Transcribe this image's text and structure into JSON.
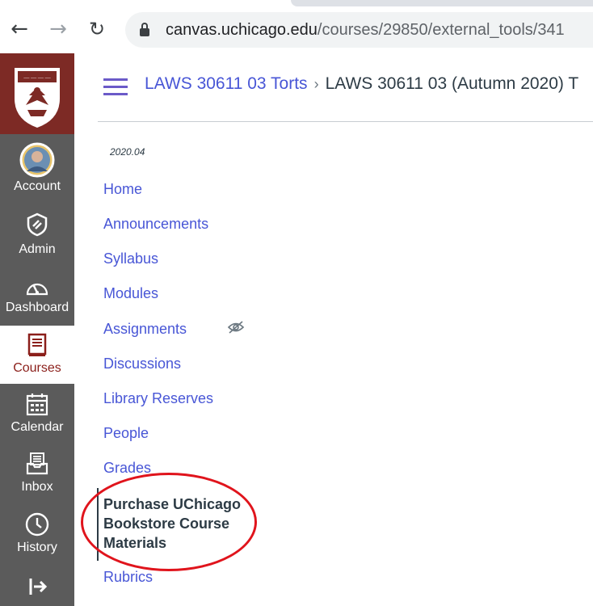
{
  "browser": {
    "back_icon": "arrow-left-icon",
    "forward_icon": "arrow-right-icon",
    "reload_icon": "reload-icon",
    "url_host": "canvas.uchicago.edu",
    "url_path": "/courses/29850/external_tools/341"
  },
  "global_nav": {
    "items": [
      {
        "label": "Account",
        "icon": "user-avatar"
      },
      {
        "label": "Admin",
        "icon": "shield-icon"
      },
      {
        "label": "Dashboard",
        "icon": "speedometer-icon"
      },
      {
        "label": "Courses",
        "icon": "book-icon",
        "active": true
      },
      {
        "label": "Calendar",
        "icon": "calendar-icon"
      },
      {
        "label": "Inbox",
        "icon": "inbox-icon"
      },
      {
        "label": "History",
        "icon": "clock-icon"
      }
    ],
    "colors": {
      "nav_bg": "#5b5b5b",
      "logo_bg": "#7d2a25",
      "active_text": "#8b1f1a"
    }
  },
  "header": {
    "course_link": "LAWS 30611 03 Torts",
    "separator": "›",
    "current": "LAWS 30611 03 (Autumn 2020) T"
  },
  "course_nav": {
    "term": "2020.04",
    "items": [
      "Home",
      "Announcements",
      "Syllabus",
      "Modules",
      "Assignments",
      "Discussions",
      "Library Reserves",
      "People",
      "Grades"
    ],
    "active_item": "Purchase UChicago Bookstore Course Materials",
    "after_active": "Rubrics",
    "link_color": "#4856d6"
  },
  "annotation": {
    "circle_color": "#e0141c"
  }
}
